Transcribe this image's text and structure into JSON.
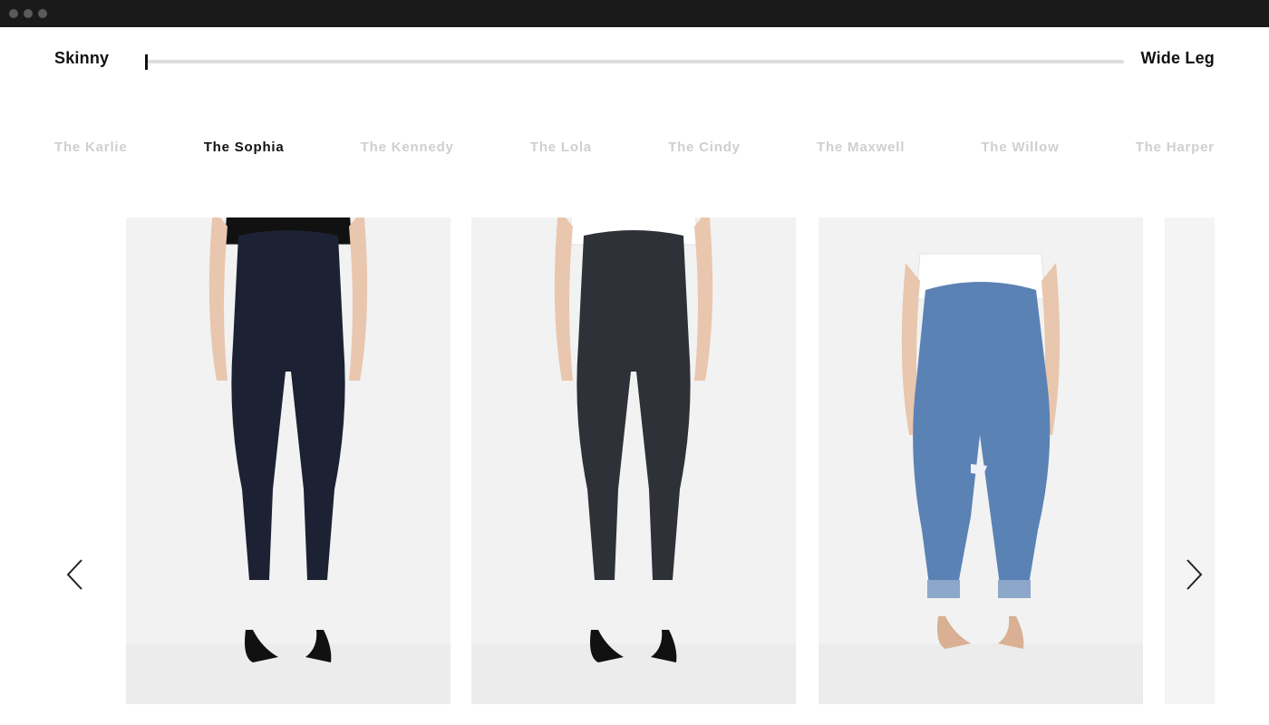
{
  "window": {
    "controls": [
      "close",
      "minimize",
      "zoom"
    ]
  },
  "fit_slider": {
    "left_label": "Skinny",
    "right_label": "Wide Leg",
    "value": 0.0
  },
  "styles": [
    {
      "label": "The Karlie",
      "active": false
    },
    {
      "label": "The Sophia",
      "active": true
    },
    {
      "label": "The Kennedy",
      "active": false
    },
    {
      "label": "The Lola",
      "active": false
    },
    {
      "label": "The Cindy",
      "active": false
    },
    {
      "label": "The Maxwell",
      "active": false
    },
    {
      "label": "The Willow",
      "active": false
    },
    {
      "label": "The Harper",
      "active": false
    }
  ],
  "carousel": {
    "prev_icon": "chevron-left-icon",
    "next_icon": "chevron-right-icon",
    "products": [
      {
        "name": "dark-rinse-cropped-skinny-jeans",
        "denim": "#1c2233",
        "top": "#111111",
        "shoes": "#111111"
      },
      {
        "name": "black-skinny-jeans",
        "denim": "#2e3138",
        "top": "#ffffff",
        "shoes": "#111111"
      },
      {
        "name": "distressed-light-wash-boyfriend-jeans",
        "denim": "#5b82b5",
        "top": "#ffffff",
        "shoes": "#d9b094"
      },
      {
        "name": "partial-next-product",
        "denim": "#e8e8e8",
        "top": "#f5f5f5",
        "shoes": "#e8e8e8"
      }
    ]
  },
  "colors": {
    "active_text": "#111111",
    "inactive_text": "#cfcfcf",
    "track": "#dedede",
    "titlebar": "#1a1a1a"
  }
}
